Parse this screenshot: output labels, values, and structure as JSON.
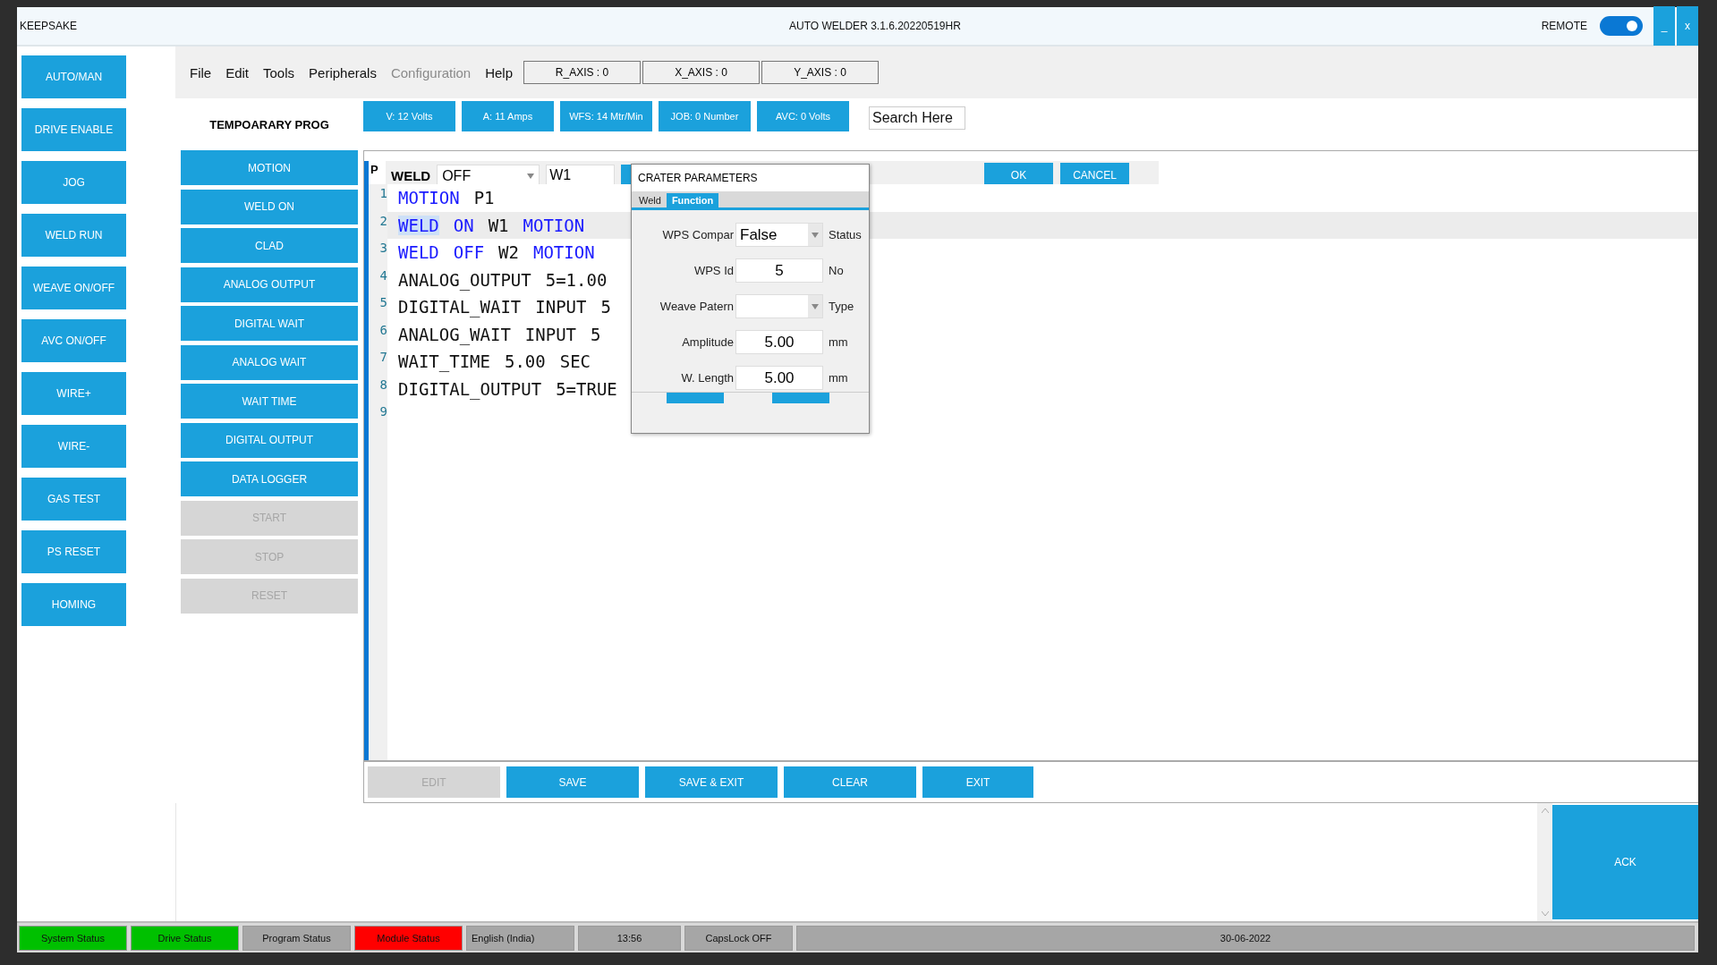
{
  "window": {
    "app": "KEEPSAKE",
    "title": "AUTO WELDER 3.1.6.20220519HR",
    "remote_label": "REMOTE",
    "remote_on": true,
    "minimize": "_",
    "close": "x"
  },
  "side_buttons": [
    "AUTO/MAN",
    "DRIVE ENABLE",
    "JOG",
    "WELD RUN",
    "WEAVE ON/OFF",
    "AVC ON/OFF",
    "WIRE+",
    "WIRE-",
    "GAS TEST",
    "PS RESET",
    "HOMING"
  ],
  "menu": [
    {
      "label": "File",
      "disabled": false
    },
    {
      "label": "Edit",
      "disabled": false
    },
    {
      "label": "Tools",
      "disabled": false
    },
    {
      "label": "Peripherals",
      "disabled": false
    },
    {
      "label": "Configuration",
      "disabled": true
    },
    {
      "label": "Help",
      "disabled": false
    }
  ],
  "axes": [
    "R_AXIS : 0",
    "X_AXIS : 0",
    "Y_AXIS : 0"
  ],
  "program_title": "TEMPOARARY PROG",
  "readings": [
    "V: 12 Volts",
    "A: 11 Amps",
    "WFS: 14 Mtr/Min",
    "JOB: 0 Number",
    "AVC: 0 Volts"
  ],
  "search": {
    "placeholder": "Search Here"
  },
  "commands": [
    {
      "label": "MOTION",
      "disabled": false
    },
    {
      "label": "WELD ON",
      "disabled": false
    },
    {
      "label": "CLAD",
      "disabled": false
    },
    {
      "label": "ANALOG OUTPUT",
      "disabled": false
    },
    {
      "label": "DIGITAL WAIT",
      "disabled": false
    },
    {
      "label": "ANALOG WAIT",
      "disabled": false
    },
    {
      "label": "WAIT TIME",
      "disabled": false
    },
    {
      "label": "DIGITAL OUTPUT",
      "disabled": false
    },
    {
      "label": "DATA LOGGER",
      "disabled": false
    },
    {
      "label": "START",
      "disabled": true
    },
    {
      "label": "STOP",
      "disabled": true
    },
    {
      "label": "RESET",
      "disabled": true
    }
  ],
  "editor": {
    "tab_label": "P",
    "weld_label": "WELD",
    "weld_mode": "OFF",
    "wire_id": "W1",
    "ok": "OK",
    "cancel": "CANCEL",
    "lines": [
      {
        "number": "1",
        "selected": false,
        "tokens": [
          {
            "text": "MOTION",
            "kind": "keyword",
            "selected": false
          },
          {
            "text": "P1",
            "kind": "plain",
            "selected": false
          }
        ]
      },
      {
        "number": "2",
        "selected": true,
        "tokens": [
          {
            "text": "WELD",
            "kind": "keyword",
            "selected": true
          },
          {
            "text": "ON",
            "kind": "keyword",
            "selected": false
          },
          {
            "text": "W1",
            "kind": "plain",
            "selected": false
          },
          {
            "text": "MOTION",
            "kind": "keyword",
            "selected": false
          }
        ]
      },
      {
        "number": "3",
        "selected": false,
        "tokens": [
          {
            "text": "WELD",
            "kind": "keyword",
            "selected": false
          },
          {
            "text": "OFF",
            "kind": "keyword",
            "selected": false
          },
          {
            "text": "W2",
            "kind": "plain",
            "selected": false
          },
          {
            "text": "MOTION",
            "kind": "keyword",
            "selected": false
          }
        ]
      },
      {
        "number": "4",
        "selected": false,
        "tokens": [
          {
            "text": "ANALOG_OUTPUT",
            "kind": "plain",
            "selected": false
          },
          {
            "text": "5=1.00",
            "kind": "plain",
            "selected": false
          }
        ]
      },
      {
        "number": "5",
        "selected": false,
        "tokens": [
          {
            "text": "DIGITAL_WAIT",
            "kind": "plain",
            "selected": false
          },
          {
            "text": "INPUT",
            "kind": "plain",
            "selected": false
          },
          {
            "text": "5",
            "kind": "plain",
            "selected": false
          }
        ]
      },
      {
        "number": "6",
        "selected": false,
        "tokens": [
          {
            "text": "ANALOG_WAIT",
            "kind": "plain",
            "selected": false
          },
          {
            "text": "INPUT",
            "kind": "plain",
            "selected": false
          },
          {
            "text": "5",
            "kind": "plain",
            "selected": false
          }
        ]
      },
      {
        "number": "7",
        "selected": false,
        "tokens": [
          {
            "text": "WAIT_TIME",
            "kind": "plain",
            "selected": false
          },
          {
            "text": "5.00",
            "kind": "plain",
            "selected": false
          },
          {
            "text": "SEC",
            "kind": "plain",
            "selected": false
          }
        ]
      },
      {
        "number": "8",
        "selected": false,
        "tokens": [
          {
            "text": "DIGITAL_OUTPUT",
            "kind": "plain",
            "selected": false
          },
          {
            "text": "5=TRUE",
            "kind": "plain",
            "selected": false
          }
        ]
      },
      {
        "number": "9",
        "selected": false
      }
    ]
  },
  "editor_buttons": [
    {
      "label": "EDIT",
      "disabled": true
    },
    {
      "label": "SAVE",
      "disabled": false
    },
    {
      "label": "SAVE & EXIT",
      "disabled": false
    },
    {
      "label": "CLEAR",
      "disabled": false
    },
    {
      "label": "EXIT",
      "disabled": false
    }
  ],
  "dialog": {
    "title": "CRATER PARAMETERS",
    "tabs": [
      {
        "label": "Weld",
        "selected": false
      },
      {
        "label": "Function",
        "selected": true
      }
    ],
    "fields": [
      {
        "label": "WPS Compar",
        "kind": "dropdown",
        "value": "False",
        "unit": "Status"
      },
      {
        "label": "WPS Id",
        "kind": "input",
        "value": "5",
        "unit": "No"
      },
      {
        "label": "Weave Patern",
        "kind": "dropdown",
        "unit": "Type"
      },
      {
        "label": "Amplitude",
        "kind": "input",
        "value": "5.00",
        "unit": "mm"
      },
      {
        "label": "W. Length",
        "kind": "input",
        "value": "5.00",
        "unit": "mm"
      }
    ]
  },
  "message": {
    "ack": "ACK"
  },
  "status_bar": [
    {
      "text": "System Status",
      "color": "#00c000"
    },
    {
      "text": "Drive Status",
      "color": "#00c000"
    },
    {
      "text": "Program Status",
      "color": "#a6a6a6"
    },
    {
      "text": "Module Status",
      "color": "#ff0000"
    },
    {
      "text": "English (India)",
      "color": "#a6a6a6"
    },
    {
      "text": "13:56",
      "color": "#a6a6a6"
    },
    {
      "text": "CapsLock OFF",
      "color": "#a6a6a6"
    },
    {
      "text": "30-06-2022",
      "color": "#a6a6a6"
    }
  ]
}
